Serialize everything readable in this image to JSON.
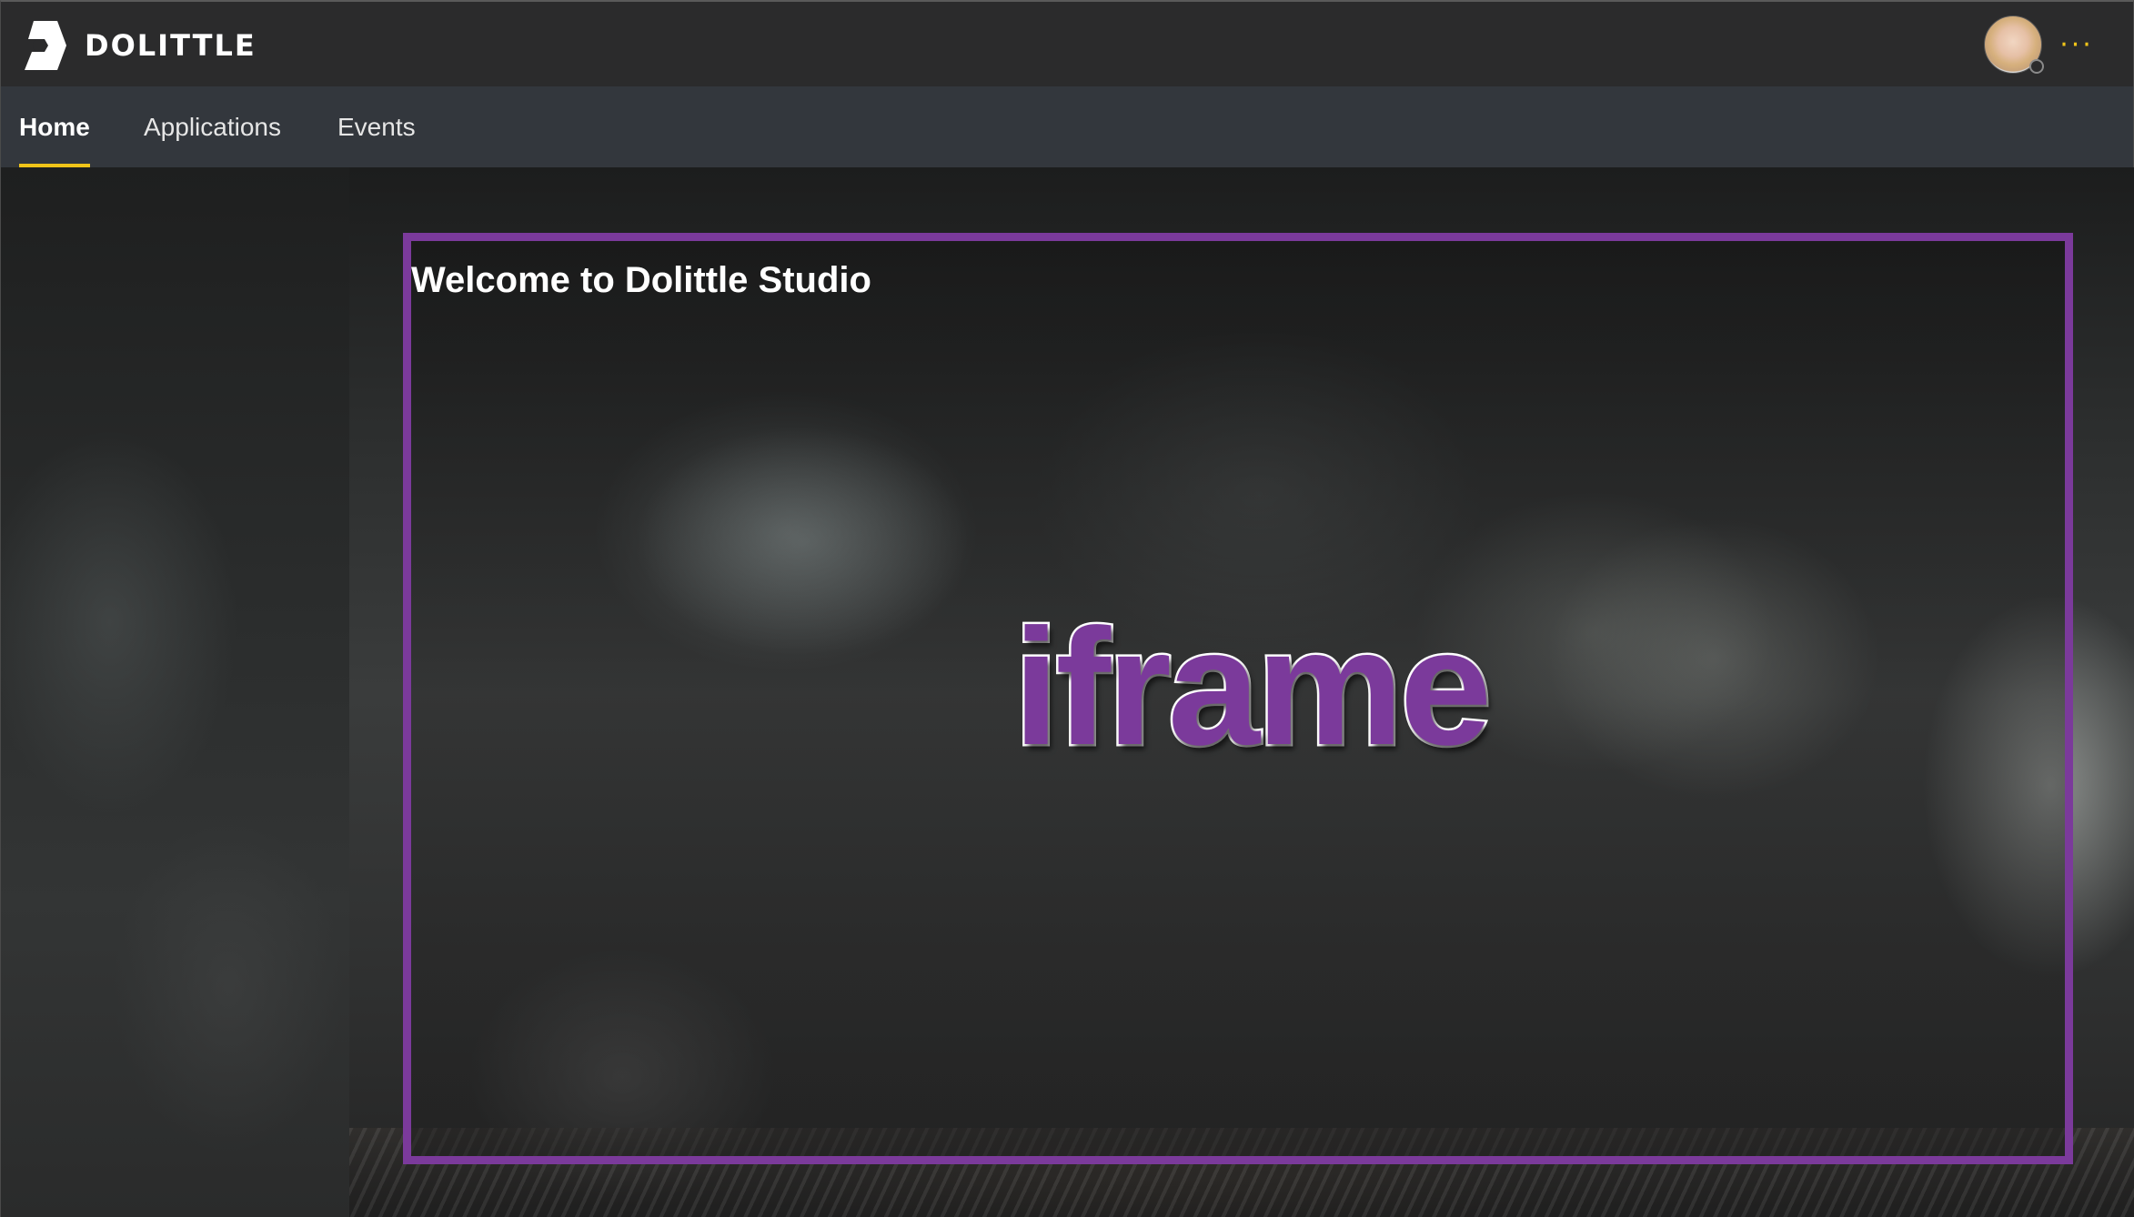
{
  "brand": {
    "name": "DOLITTLE",
    "icon": "dolittle-logo-icon"
  },
  "header": {
    "more_icon": "ellipsis-icon",
    "more_glyph": "···",
    "avatar": "user-avatar",
    "presence": "presence-offline-indicator"
  },
  "nav": {
    "tabs": [
      {
        "label": "Home",
        "active": true
      },
      {
        "label": "Applications",
        "active": false
      },
      {
        "label": "Events",
        "active": false
      }
    ]
  },
  "main": {
    "title": "Welcome to Dolittle Studio",
    "iframe_label": "iframe"
  },
  "colors": {
    "accent": "#f0c419",
    "iframe_border": "#7b3a9b",
    "topbar": "#2b2b2c",
    "navbar": "#33373d"
  }
}
